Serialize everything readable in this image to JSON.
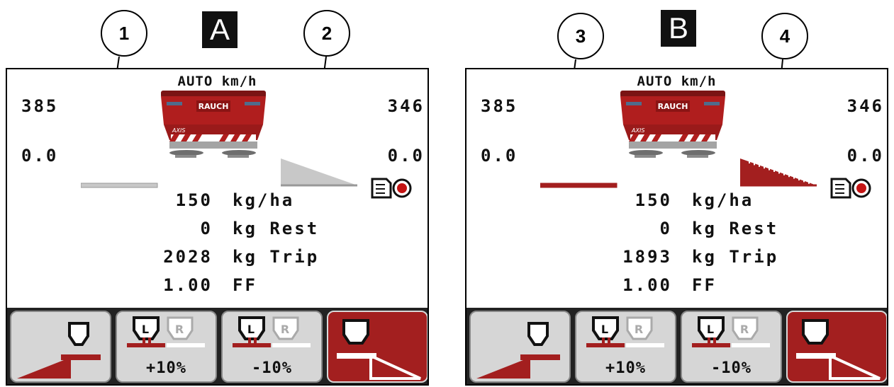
{
  "callouts": [
    "1",
    "2",
    "3",
    "4"
  ],
  "panel_labels": [
    "A",
    "B"
  ],
  "panels": [
    {
      "mode_label": "AUTO km/h",
      "brand": "RAUCH",
      "model": "AXIS",
      "left_value_top": "385",
      "right_value_top": "346",
      "left_value_mid": "0.0",
      "right_value_mid": "0.0",
      "rows": [
        {
          "num": "150",
          "unit": "kg/ha"
        },
        {
          "num": "0",
          "unit": "kg Rest"
        },
        {
          "num": "2028",
          "unit": "kg Trip"
        },
        {
          "num": "1.00",
          "unit": "FF"
        }
      ],
      "indicator_color": "#c8c8c8",
      "buttons": [
        {
          "label": "",
          "style": "grey"
        },
        {
          "label": "+10%",
          "style": "grey"
        },
        {
          "label": "-10%",
          "style": "grey"
        },
        {
          "label": "",
          "style": "red"
        }
      ]
    },
    {
      "mode_label": "AUTO km/h",
      "brand": "RAUCH",
      "model": "AXIS",
      "left_value_top": "385",
      "right_value_top": "346",
      "left_value_mid": "0.0",
      "right_value_mid": "0.0",
      "rows": [
        {
          "num": "150",
          "unit": "kg/ha"
        },
        {
          "num": "0",
          "unit": "kg Rest"
        },
        {
          "num": "1893",
          "unit": "kg Trip"
        },
        {
          "num": "1.00",
          "unit": "FF"
        }
      ],
      "indicator_color": "#a31f1f",
      "buttons": [
        {
          "label": "",
          "style": "grey"
        },
        {
          "label": "+10%",
          "style": "grey"
        },
        {
          "label": "-10%",
          "style": "grey"
        },
        {
          "label": "",
          "style": "red"
        }
      ]
    }
  ]
}
